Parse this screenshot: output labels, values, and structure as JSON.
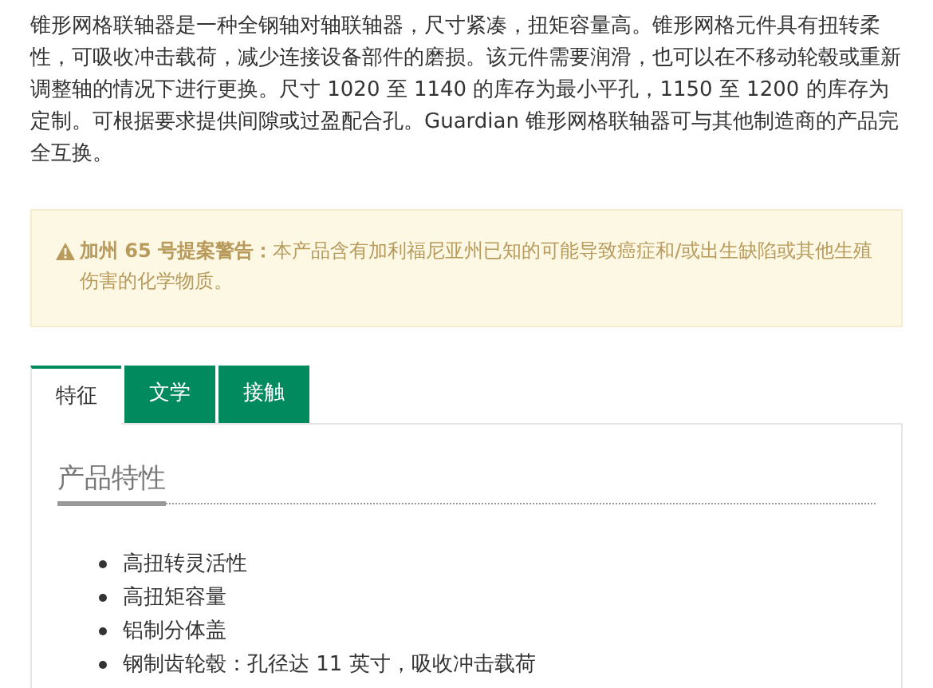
{
  "description": "锥形网格联轴器是一种全钢轴对轴联轴器，尺寸紧凑，扭矩容量高。锥形网格元件具有扭转柔性，可吸收冲击载荷，减少连接设备部件的磨损。该元件需要润滑，也可以在不移动轮毂或重新调整轴的情况下进行更换。尺寸 1020 至 1140 的库存为最小平孔，1150 至 1200 的库存为定制。可根据要求提供间隙或过盈配合孔。Guardian 锥形网格联轴器可与其他制造商的产品完全互换。",
  "warning": {
    "text": "**加州 65 号提案警告：**本产品含有加利福尼亚州已知的可能导致癌症和/或出生缺陷或其他生殖伤害的化学物质。"
  },
  "tabs": [
    {
      "label": "特征",
      "selected": true
    },
    {
      "label": "文学",
      "selected": false
    },
    {
      "label": "接触",
      "selected": false
    }
  ],
  "panel": {
    "heading": "产品特性",
    "items": [
      "高扭转灵活性",
      "高扭矩容量",
      "铝制分体盖",
      "钢制齿轮毂：孔径达 11 英寸，吸收冲击载荷"
    ]
  }
}
